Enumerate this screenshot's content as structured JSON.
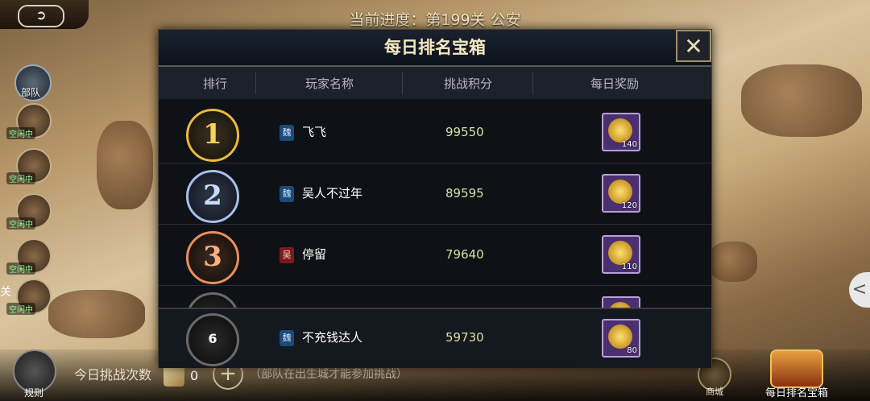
{
  "topbar": {
    "back_icon": "back-arrow-icon",
    "progress": "当前进度：第199关 公安"
  },
  "left": {
    "troop_label": "部队",
    "idle_label": "空闲中",
    "left_edge_label": "关"
  },
  "bottom": {
    "rule_label": "规则",
    "challenge_label": "今日挑战次数",
    "challenge_count": "0",
    "plus_label": "+",
    "hint": "（部队在出生城才能参加挑战）",
    "shop_label": "商城",
    "chest_label": "每日排名宝箱"
  },
  "dialog": {
    "title": "每日排名宝箱",
    "close_label": "✕",
    "headers": [
      "排行",
      "玩家名称",
      "挑战积分",
      "每日奖励"
    ],
    "rows": [
      {
        "rank": "1",
        "faction": "魏",
        "name": "飞飞",
        "score": "99550",
        "reward_qty": "140"
      },
      {
        "rank": "2",
        "faction": "魏",
        "name": "吴人不过年",
        "score": "89595",
        "reward_qty": "120"
      },
      {
        "rank": "3",
        "faction": "吴",
        "name": "停留",
        "score": "79640",
        "reward_qty": "110"
      }
    ],
    "me": {
      "rank": "6",
      "faction": "魏",
      "name": "不充钱达人",
      "score": "59730",
      "reward_qty": "80"
    }
  },
  "colors": {
    "gold": "#e8b840",
    "silver": "#a8c0e8",
    "bronze": "#e89060",
    "wei": "#1c4a7a",
    "wu": "#7a1c1c",
    "reward_bg": "#4a3070"
  }
}
